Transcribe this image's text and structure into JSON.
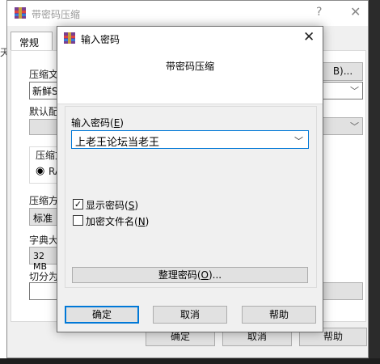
{
  "back_window": {
    "title": "带密码压缩",
    "help_glyph": "?",
    "close_glyph": "✕",
    "tab_general": "常规",
    "label_archive_name": "压缩文",
    "archive_name_value": "新鲜S",
    "browse_button": "B)...",
    "label_default_profile": "默认配",
    "label_compress_format": "压缩文",
    "format_radio_label": "RA",
    "label_compress_method": "压缩方",
    "compress_method_value": "标准",
    "label_dictionary": "字典大",
    "dictionary_value": "32 MB",
    "label_split": "切分为",
    "ok_button": "确定",
    "cancel_button": "取消",
    "help_button": "帮助",
    "edge_char": "天"
  },
  "dialog": {
    "title": "输入密码",
    "close_glyph": "✕",
    "heading": "带密码压缩",
    "password_label": "输入密码(",
    "password_label_key": "E",
    "password_label_end": ")",
    "password_value": "上老王论坛当老王",
    "show_password_label": "显示密码(",
    "show_password_key": "S",
    "show_password_checked": true,
    "encrypt_names_label": "加密文件名(",
    "encrypt_names_key": "N",
    "encrypt_names_checked": false,
    "organize_button": "整理密码(",
    "organize_key": "O",
    "organize_end": ")...",
    "ok_button": "确定",
    "cancel_button": "取消",
    "help_button": "帮助"
  },
  "icons": {
    "winrar": "winrar-icon",
    "chevron": "chevron-down-icon",
    "check": "check-icon"
  },
  "colors": {
    "accent": "#0078d7",
    "dialog_bg": "#f0f0f0",
    "button_bg": "#e1e1e1"
  }
}
